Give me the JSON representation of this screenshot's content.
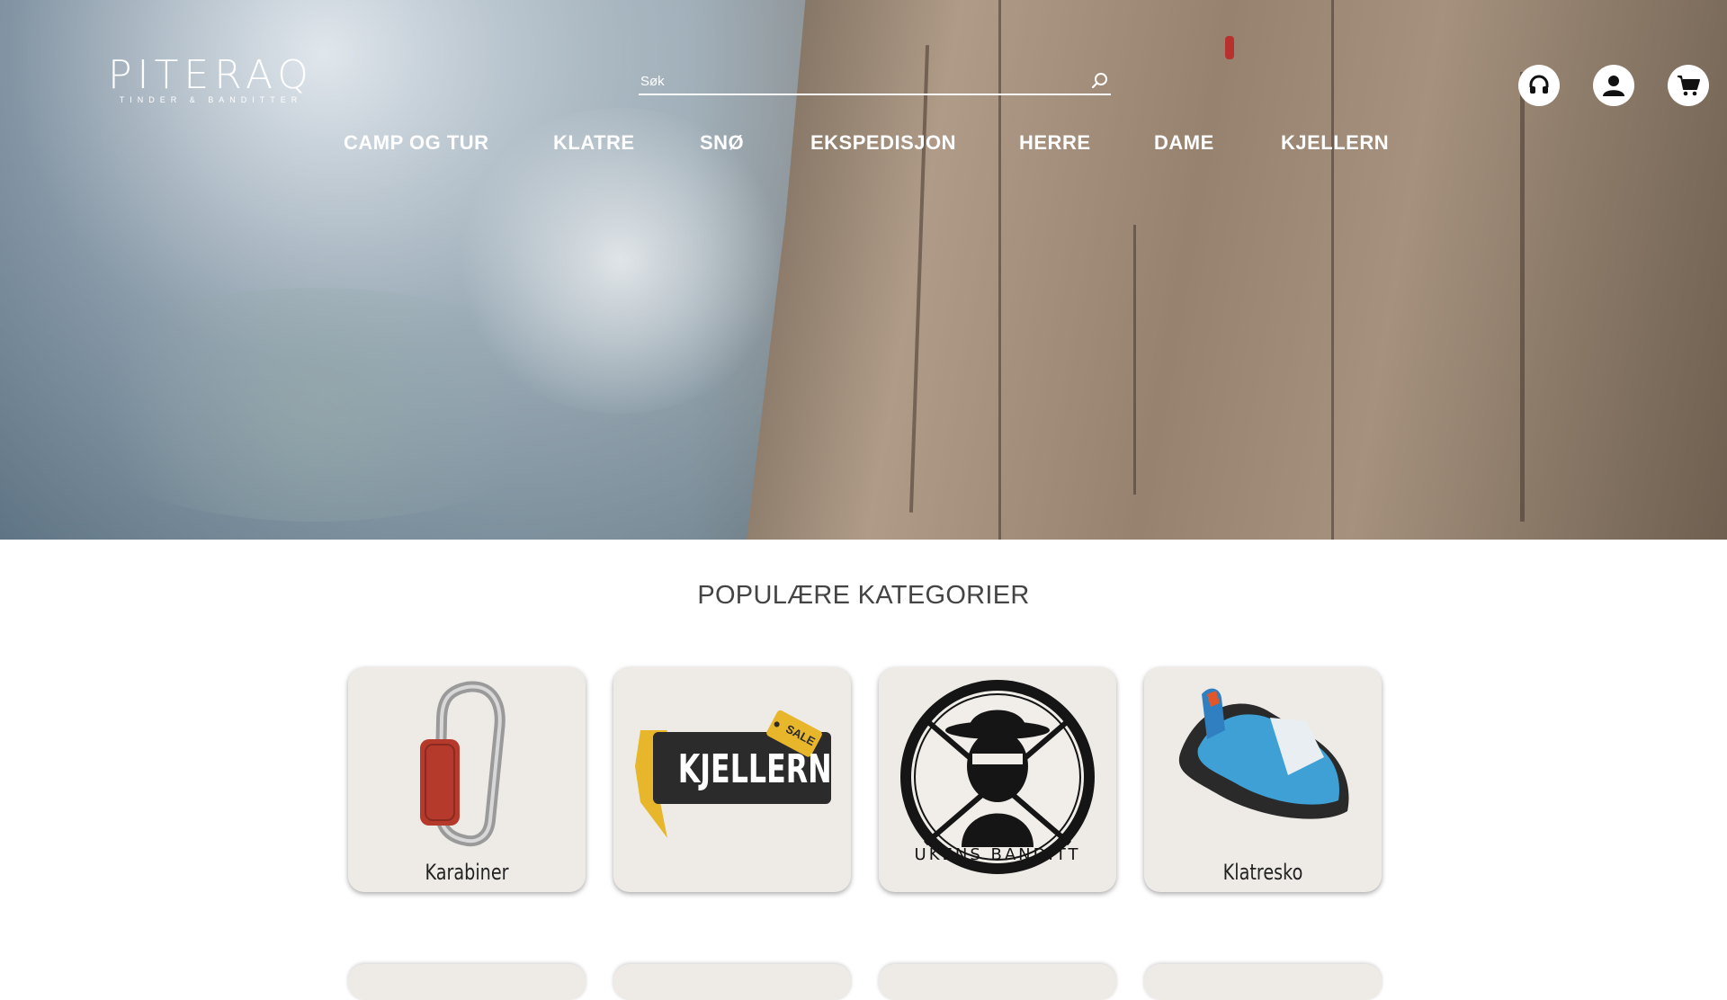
{
  "logo": {
    "name": "PITERAQ",
    "tagline": "TINDER & BANDITTER"
  },
  "search": {
    "placeholder": "Søk"
  },
  "header_icons": [
    "headset-icon",
    "user-icon",
    "cart-icon"
  ],
  "nav": {
    "items": [
      {
        "label": "CAMP OG TUR"
      },
      {
        "label": "KLATRE"
      },
      {
        "label": "SNØ"
      },
      {
        "label": "EKSPEDISJON"
      },
      {
        "label": "HERRE"
      },
      {
        "label": "DAME"
      },
      {
        "label": "KJELLERN"
      }
    ]
  },
  "categories": {
    "title": "POPULÆRE KATEGORIER",
    "items": [
      {
        "label": "Karabiner"
      },
      {
        "label": "KJELLERN",
        "badge": "SALE"
      },
      {
        "label": "UKENS BANDITT"
      },
      {
        "label": "Klatresko"
      }
    ]
  },
  "colors": {
    "header_text": "#ffffff",
    "title_text": "#444444",
    "card_bg": "#eeebe7"
  }
}
